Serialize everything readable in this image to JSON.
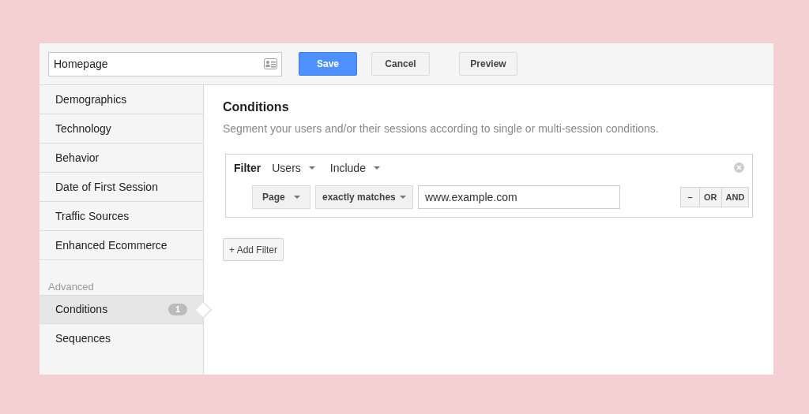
{
  "header": {
    "name_field": {
      "value": "Homepage"
    },
    "buttons": [
      {
        "label": "Save",
        "kind": "primary"
      },
      {
        "label": "Cancel",
        "kind": "default"
      },
      {
        "label": "Preview",
        "kind": "default"
      }
    ]
  },
  "sidebar": {
    "items": [
      {
        "label": "Demographics",
        "selected": false
      },
      {
        "label": "Technology",
        "selected": false
      },
      {
        "label": "Behavior",
        "selected": false
      },
      {
        "label": "Date of First Session",
        "selected": false
      },
      {
        "label": "Traffic Sources",
        "selected": false
      },
      {
        "label": "Enhanced Ecommerce",
        "selected": false
      }
    ],
    "sections": [
      {
        "heading": "Advanced",
        "items": [
          {
            "label": "Conditions",
            "badge": "1",
            "selected": true
          },
          {
            "label": "Sequences",
            "selected": false
          }
        ]
      }
    ]
  },
  "main": {
    "title": "Conditions",
    "subtitle": "Segment your users and/or their sessions according to single or multi-session conditions.",
    "filter": {
      "label": "Filter",
      "scope": "Users",
      "mode": "Include",
      "dimension": "Page",
      "operator": "exactly matches",
      "value": "www.example.com",
      "logic_buttons": [
        "–",
        "OR",
        "AND"
      ]
    },
    "add_button": "+ Add Filter"
  }
}
